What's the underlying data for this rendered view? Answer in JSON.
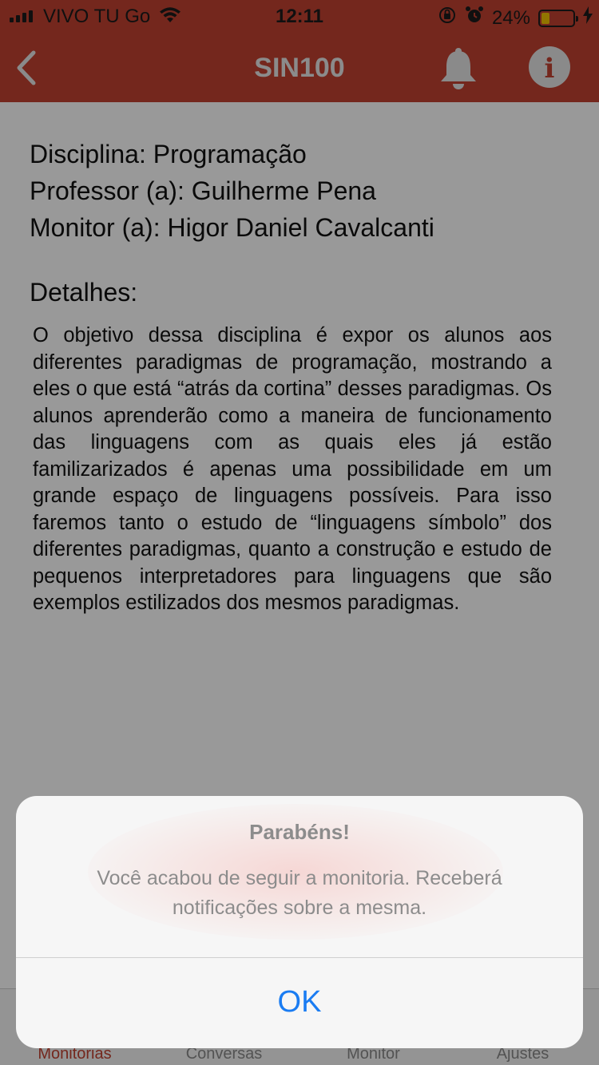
{
  "status_bar": {
    "carrier": "VIVO TU Go",
    "time": "12:11",
    "battery_percent": "24%"
  },
  "nav": {
    "title": "SIN100",
    "icons": [
      "back-chevron-icon",
      "bell-icon",
      "info-icon"
    ]
  },
  "course": {
    "discipline": "Disciplina: Programação",
    "professor": "Professor (a): Guilherme Pena",
    "monitor": "Monitor (a): Higor Daniel Cavalcanti",
    "details_label": "Detalhes:",
    "details_text": "O objetivo dessa disciplina é expor os alunos aos diferentes paradigmas de programação, mostrando a eles o que está “atrás da cortina” desses paradigmas. Os alunos aprenderão como a maneira de funcionamento das linguagens com as quais eles já estão familizarizados é apenas uma possibilidade em um grande espaço de linguagens possíveis. Para isso faremos tanto o estudo de “linguagens símbolo” dos diferentes paradigmas, quanto a construção e estudo de pequenos interpretadores para linguagens que são exemplos estilizados dos mesmos paradigmas."
  },
  "tab_bar": {
    "tabs": [
      {
        "label": "Monitorias",
        "active": true
      },
      {
        "label": "Conversas",
        "active": false
      },
      {
        "label": "Monitor",
        "active": false
      },
      {
        "label": "Ajustes",
        "active": false
      }
    ]
  },
  "alert": {
    "title": "Parabéns!",
    "message": "Você acabou de seguir a monitoria. Receberá notificações sobre a mesma.",
    "ok_label": "OK"
  },
  "colors": {
    "brand_red": "#c24231",
    "ios_blue": "#1a7cf2"
  }
}
